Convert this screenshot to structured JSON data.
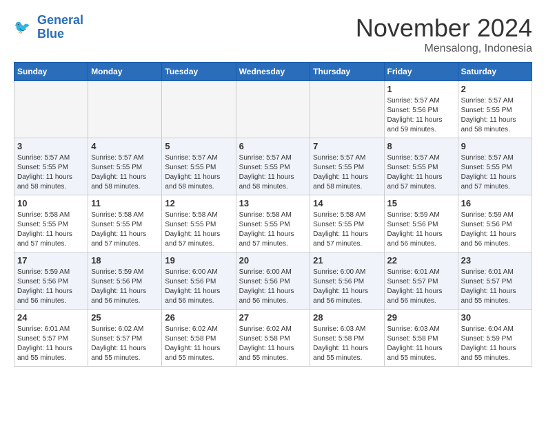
{
  "header": {
    "logo_line1": "General",
    "logo_line2": "Blue",
    "month_title": "November 2024",
    "subtitle": "Mensalong, Indonesia"
  },
  "weekdays": [
    "Sunday",
    "Monday",
    "Tuesday",
    "Wednesday",
    "Thursday",
    "Friday",
    "Saturday"
  ],
  "weeks": [
    [
      {
        "day": "",
        "info": ""
      },
      {
        "day": "",
        "info": ""
      },
      {
        "day": "",
        "info": ""
      },
      {
        "day": "",
        "info": ""
      },
      {
        "day": "",
        "info": ""
      },
      {
        "day": "1",
        "info": "Sunrise: 5:57 AM\nSunset: 5:56 PM\nDaylight: 11 hours\nand 59 minutes."
      },
      {
        "day": "2",
        "info": "Sunrise: 5:57 AM\nSunset: 5:55 PM\nDaylight: 11 hours\nand 58 minutes."
      }
    ],
    [
      {
        "day": "3",
        "info": "Sunrise: 5:57 AM\nSunset: 5:55 PM\nDaylight: 11 hours\nand 58 minutes."
      },
      {
        "day": "4",
        "info": "Sunrise: 5:57 AM\nSunset: 5:55 PM\nDaylight: 11 hours\nand 58 minutes."
      },
      {
        "day": "5",
        "info": "Sunrise: 5:57 AM\nSunset: 5:55 PM\nDaylight: 11 hours\nand 58 minutes."
      },
      {
        "day": "6",
        "info": "Sunrise: 5:57 AM\nSunset: 5:55 PM\nDaylight: 11 hours\nand 58 minutes."
      },
      {
        "day": "7",
        "info": "Sunrise: 5:57 AM\nSunset: 5:55 PM\nDaylight: 11 hours\nand 58 minutes."
      },
      {
        "day": "8",
        "info": "Sunrise: 5:57 AM\nSunset: 5:55 PM\nDaylight: 11 hours\nand 57 minutes."
      },
      {
        "day": "9",
        "info": "Sunrise: 5:57 AM\nSunset: 5:55 PM\nDaylight: 11 hours\nand 57 minutes."
      }
    ],
    [
      {
        "day": "10",
        "info": "Sunrise: 5:58 AM\nSunset: 5:55 PM\nDaylight: 11 hours\nand 57 minutes."
      },
      {
        "day": "11",
        "info": "Sunrise: 5:58 AM\nSunset: 5:55 PM\nDaylight: 11 hours\nand 57 minutes."
      },
      {
        "day": "12",
        "info": "Sunrise: 5:58 AM\nSunset: 5:55 PM\nDaylight: 11 hours\nand 57 minutes."
      },
      {
        "day": "13",
        "info": "Sunrise: 5:58 AM\nSunset: 5:55 PM\nDaylight: 11 hours\nand 57 minutes."
      },
      {
        "day": "14",
        "info": "Sunrise: 5:58 AM\nSunset: 5:55 PM\nDaylight: 11 hours\nand 57 minutes."
      },
      {
        "day": "15",
        "info": "Sunrise: 5:59 AM\nSunset: 5:56 PM\nDaylight: 11 hours\nand 56 minutes."
      },
      {
        "day": "16",
        "info": "Sunrise: 5:59 AM\nSunset: 5:56 PM\nDaylight: 11 hours\nand 56 minutes."
      }
    ],
    [
      {
        "day": "17",
        "info": "Sunrise: 5:59 AM\nSunset: 5:56 PM\nDaylight: 11 hours\nand 56 minutes."
      },
      {
        "day": "18",
        "info": "Sunrise: 5:59 AM\nSunset: 5:56 PM\nDaylight: 11 hours\nand 56 minutes."
      },
      {
        "day": "19",
        "info": "Sunrise: 6:00 AM\nSunset: 5:56 PM\nDaylight: 11 hours\nand 56 minutes."
      },
      {
        "day": "20",
        "info": "Sunrise: 6:00 AM\nSunset: 5:56 PM\nDaylight: 11 hours\nand 56 minutes."
      },
      {
        "day": "21",
        "info": "Sunrise: 6:00 AM\nSunset: 5:56 PM\nDaylight: 11 hours\nand 56 minutes."
      },
      {
        "day": "22",
        "info": "Sunrise: 6:01 AM\nSunset: 5:57 PM\nDaylight: 11 hours\nand 56 minutes."
      },
      {
        "day": "23",
        "info": "Sunrise: 6:01 AM\nSunset: 5:57 PM\nDaylight: 11 hours\nand 55 minutes."
      }
    ],
    [
      {
        "day": "24",
        "info": "Sunrise: 6:01 AM\nSunset: 5:57 PM\nDaylight: 11 hours\nand 55 minutes."
      },
      {
        "day": "25",
        "info": "Sunrise: 6:02 AM\nSunset: 5:57 PM\nDaylight: 11 hours\nand 55 minutes."
      },
      {
        "day": "26",
        "info": "Sunrise: 6:02 AM\nSunset: 5:58 PM\nDaylight: 11 hours\nand 55 minutes."
      },
      {
        "day": "27",
        "info": "Sunrise: 6:02 AM\nSunset: 5:58 PM\nDaylight: 11 hours\nand 55 minutes."
      },
      {
        "day": "28",
        "info": "Sunrise: 6:03 AM\nSunset: 5:58 PM\nDaylight: 11 hours\nand 55 minutes."
      },
      {
        "day": "29",
        "info": "Sunrise: 6:03 AM\nSunset: 5:58 PM\nDaylight: 11 hours\nand 55 minutes."
      },
      {
        "day": "30",
        "info": "Sunrise: 6:04 AM\nSunset: 5:59 PM\nDaylight: 11 hours\nand 55 minutes."
      }
    ]
  ]
}
